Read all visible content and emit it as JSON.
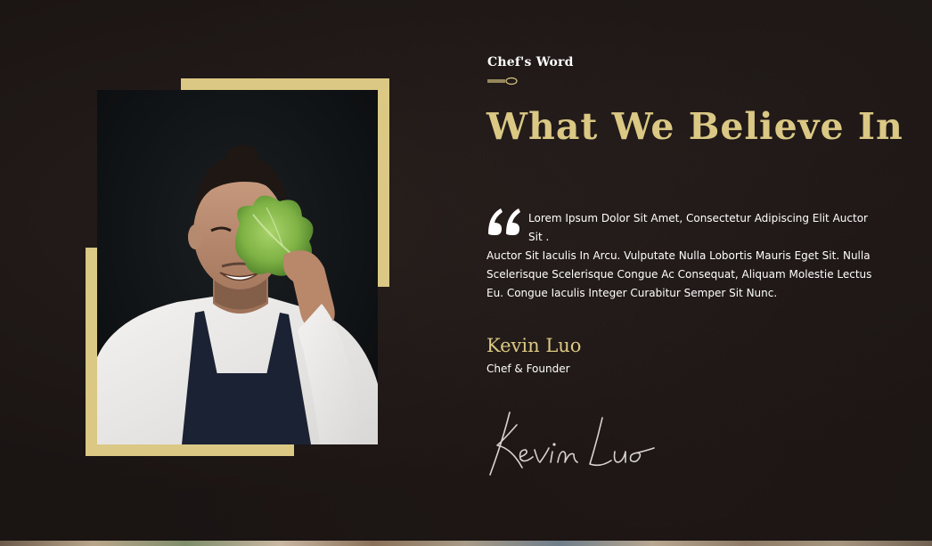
{
  "section": {
    "eyebrow": "Chef's Word",
    "headline": "What We Believe In"
  },
  "quote": {
    "lead": "Lorem Ipsum Dolor Sit Amet, Consectetur Adipiscing Elit Auctor Sit .",
    "body": "Auctor Sit Iaculis In Arcu. Vulputate Nulla Lobortis Mauris Eget Sit. Nulla Scelerisque Scelerisque Congue Ac Consequat, Aliquam Molestie Lectus Eu. Congue Iaculis Integer Curabitur Semper Sit Nunc."
  },
  "author": {
    "name": "Kevin Luo",
    "role": "Chef & Founder",
    "signature": "Kevin Luo"
  },
  "icons": {
    "divider": "spoon-icon",
    "quote": "quote-icon"
  },
  "colors": {
    "accent_gold": "#dac884",
    "background": "#1a1413",
    "text": "#ffffff"
  }
}
